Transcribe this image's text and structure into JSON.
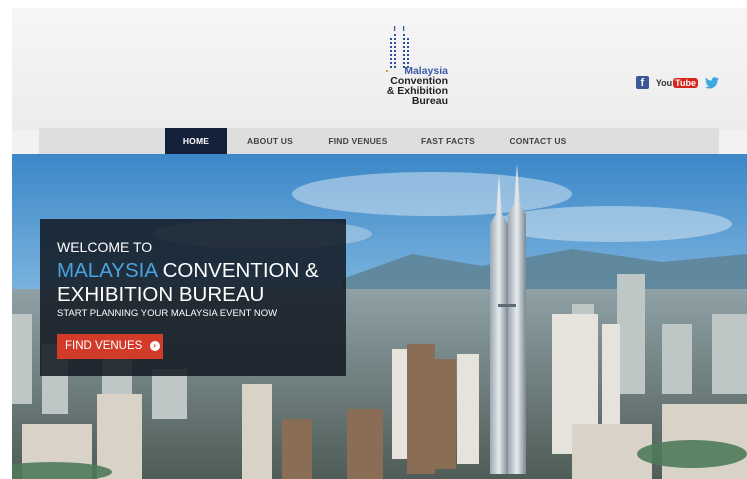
{
  "logo": {
    "line1": "Malaysia",
    "line2": "Convention",
    "line3": "& Exhibition",
    "line4": "Bureau"
  },
  "social": {
    "facebook": "f",
    "youtube_you": "You",
    "youtube_tube": "Tube"
  },
  "nav": {
    "items": [
      {
        "label": "HOME"
      },
      {
        "label": "ABOUT US"
      },
      {
        "label": "FIND VENUES"
      },
      {
        "label": "FAST FACTS"
      },
      {
        "label": "CONTACT US"
      }
    ]
  },
  "hero": {
    "welcome": "WELCOME TO",
    "title_highlight": "MALAYSIA",
    "title_rest1": "CONVENTION &",
    "title_rest2": "EXHIBITION BUREAU",
    "tagline": "START PLANNING YOUR MALAYSIA EVENT NOW",
    "button_label": "FIND VENUES",
    "button_icon": "›"
  },
  "colors": {
    "nav_active": "#15213b",
    "accent_blue": "#4aa3de",
    "button_red": "#d23a2a"
  }
}
